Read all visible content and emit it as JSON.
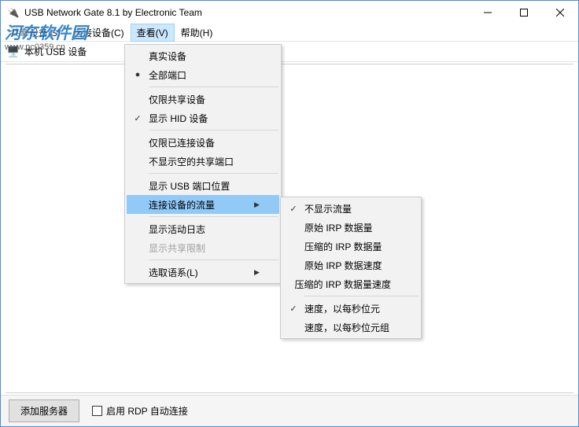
{
  "window": {
    "title": "USB Network Gate 8.1 by Electronic Team"
  },
  "watermark": {
    "line1": "河东软件园",
    "line2": "www.pc0359.cn"
  },
  "menubar": {
    "items": [
      {
        "label": "共享设备(S)"
      },
      {
        "label": "连接设备(C)"
      },
      {
        "label": "查看(V)"
      },
      {
        "label": "帮助(H)"
      }
    ]
  },
  "toolbar": {
    "label": "本机 USB 设备"
  },
  "view_menu": {
    "items": [
      {
        "label": "真实设备",
        "check": ""
      },
      {
        "label": "全部端口",
        "check": "●"
      },
      {
        "sep": true
      },
      {
        "label": "仅限共享设备",
        "check": ""
      },
      {
        "label": "显示 HID 设备",
        "check": "✓"
      },
      {
        "sep": true
      },
      {
        "label": "仅限已连接设备",
        "check": ""
      },
      {
        "label": "不显示空的共享端口",
        "check": ""
      },
      {
        "sep": true
      },
      {
        "label": "显示 USB 端口位置",
        "check": ""
      },
      {
        "label": "连接设备的流量",
        "check": "",
        "submenu": true,
        "highlighted": true
      },
      {
        "sep": true
      },
      {
        "label": "显示活动日志",
        "check": ""
      },
      {
        "label": "显示共享限制",
        "check": "",
        "disabled": true
      },
      {
        "sep": true
      },
      {
        "label": "选取语系(L)",
        "check": "",
        "submenu": true
      }
    ]
  },
  "traffic_submenu": {
    "items": [
      {
        "label": "不显示流量",
        "check": "✓"
      },
      {
        "label": "原始 IRP 数据量",
        "check": ""
      },
      {
        "label": "压缩的 IRP 数据量",
        "check": ""
      },
      {
        "label": "原始 IRP 数据速度",
        "check": ""
      },
      {
        "label": "压缩的 IRP 数据量速度",
        "check": ""
      },
      {
        "sep": true
      },
      {
        "label": "速度，以每秒位元",
        "check": "✓"
      },
      {
        "label": "速度，以每秒位元组",
        "check": ""
      }
    ]
  },
  "bottombar": {
    "add_server": "添加服务器",
    "rdp_auto": "启用 RDP 自动连接"
  }
}
